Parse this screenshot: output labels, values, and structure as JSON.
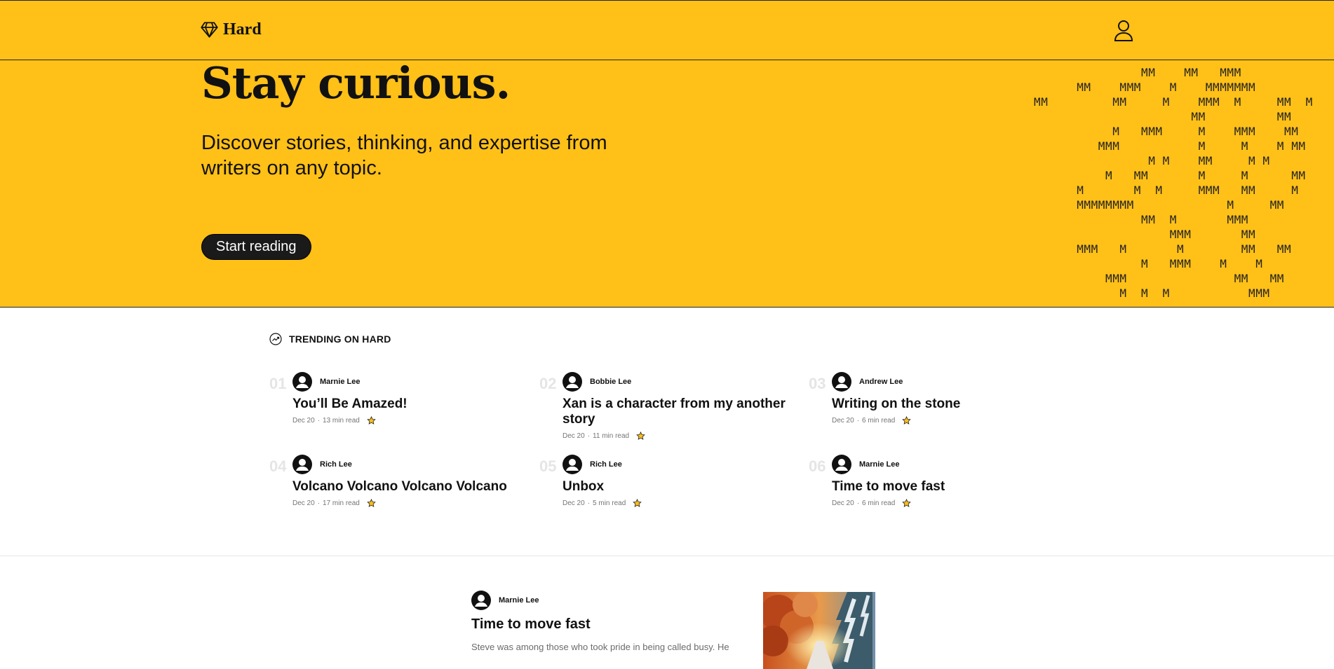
{
  "header": {
    "logo_text": "Hard",
    "logo_icon": "diamond-icon",
    "user_icon": "user-icon"
  },
  "hero": {
    "headline": "Stay curious.",
    "subheadline": "Discover stories, thinking, and expertise from writers on any topic.",
    "cta_label": "Start reading",
    "pattern_glyph": "M"
  },
  "trending": {
    "heading": "TRENDING ON HARD",
    "icon": "trending-icon",
    "items": [
      {
        "num": "01",
        "author": "Marnie Lee",
        "title": "You’ll Be Amazed!",
        "date": "Dec 20",
        "read": "13 min read"
      },
      {
        "num": "02",
        "author": "Bobbie Lee",
        "title": "Xan is a character from my another story",
        "date": "Dec 20",
        "read": "11 min read"
      },
      {
        "num": "03",
        "author": "Andrew Lee",
        "title": "Writing on the stone",
        "date": "Dec 20",
        "read": "6 min read"
      },
      {
        "num": "04",
        "author": "Rich Lee",
        "title": "Volcano Volcano Volcano Volcano",
        "date": "Dec 20",
        "read": "17 min read"
      },
      {
        "num": "05",
        "author": "Rich Lee",
        "title": "Unbox",
        "date": "Dec 20",
        "read": "5 min read"
      },
      {
        "num": "06",
        "author": "Marnie Lee",
        "title": "Time to move fast",
        "date": "Dec 20",
        "read": "6 min read"
      }
    ]
  },
  "feed": {
    "post": {
      "author": "Marnie Lee",
      "title": "Time to move fast",
      "excerpt": "Steve was among those who took pride in being called busy. He"
    }
  },
  "colors": {
    "brand_yellow": "#ffc017",
    "dark": "#111111"
  }
}
